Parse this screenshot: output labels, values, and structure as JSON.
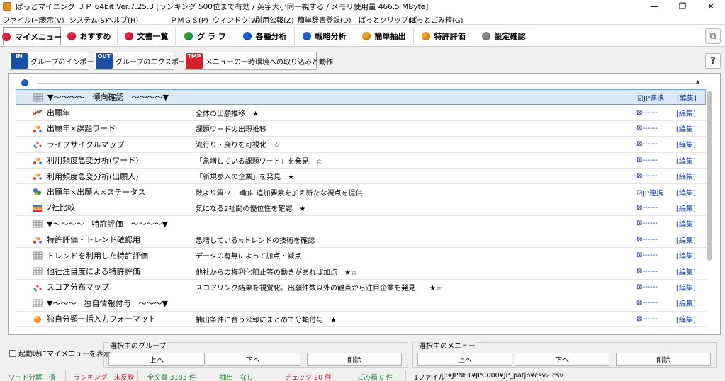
{
  "window": {
    "title": "ぱっとマイニング ＪＰ 64bit Ver.7.25.3 [ランキング 500位まで有効 / 英字大小同一視する / メモリ使用量 466.5 MByte]",
    "controls": [
      "—",
      "❐",
      "✕"
    ]
  },
  "menubar": [
    "ファイル(F)",
    "表示(V)",
    "システム(S)",
    "ヘルプ(H)",
    "ＰＭＧＳ(P)",
    "ウィンドウ(W)",
    "引用公報(Z)",
    "簡単辞書登録(D)",
    "ぱっとクリップ(8)",
    "ぱっとごみ箱(G)"
  ],
  "tabs": [
    {
      "label": "マイメニュー",
      "color": "#e8243c",
      "active": true
    },
    {
      "label": "おすすめ",
      "color": "#e8243c"
    },
    {
      "label": "文書一覧",
      "color": "#e8243c"
    },
    {
      "label": "グ ラ フ",
      "color": "#2aa13a"
    },
    {
      "label": "各種分析",
      "color": "#1565e0"
    },
    {
      "label": "戦略分析",
      "color": "#1565e0"
    },
    {
      "label": "簡単抽出",
      "color": "#f0a020"
    },
    {
      "label": "特許評価",
      "color": "#f0a020"
    },
    {
      "label": "設定確認",
      "color": "#8a8a8a"
    }
  ],
  "toolbar": {
    "import": {
      "icon_text": "IN",
      "label": "グループのインポート",
      "color": "#1a4fa8"
    },
    "export": {
      "icon_text": "OUT",
      "label": "グループのエクスポート",
      "color": "#1a4fa8"
    },
    "temp": {
      "icon_text": "TMP",
      "label": "メニューの一時環境への取り込みと動作",
      "color": "#d21f2a"
    },
    "help_icon": "?",
    "window_icon": "⧉"
  },
  "list": {
    "collapse_icon": "▴",
    "rows": [
      {
        "icon": "grid-icon",
        "name": "▼〜〜〜〜　傾向確認　〜〜〜〜▼",
        "desc": "",
        "link": "☑JP連携",
        "edit": "[編集]",
        "selected": true
      },
      {
        "icon": "line-chart-icon",
        "name": "出願年",
        "desc": "全体の出願推移　★",
        "link": "⊠------",
        "edit": "[編集]"
      },
      {
        "icon": "bubble-chart-icon",
        "name": "出願年×課題ワード",
        "desc": "課題ワードの出現推移",
        "link": "⊠------",
        "edit": "[編集]"
      },
      {
        "icon": "scatter-icon",
        "name": "ライフサイクルマップ",
        "desc": "流行り・廃りを可視化　☆",
        "link": "⊠------",
        "edit": "[編集]"
      },
      {
        "icon": "bubble-chart-icon",
        "name": "利用頻度急変分析(ワード)",
        "desc": "「急増している課題ワード」を発見　☆",
        "link": "⊠------",
        "edit": "[編集]"
      },
      {
        "icon": "bubble-chart-icon",
        "name": "利用頻度急変分析(出願人)",
        "desc": "「新規参入の企業」を発見　★",
        "link": "⊠------",
        "edit": "[編集]"
      },
      {
        "icon": "cluster-icon",
        "name": "出願年×出願人×ステータス",
        "desc": "数より質!?　3軸に追加要素を加え新たな視点を提供",
        "link": "☑JP連携",
        "edit": "[編集]"
      },
      {
        "icon": "stacked-bar-icon",
        "name": "2社比較",
        "desc": "気になる2社間の優位性を確認　★",
        "link": "⊠------",
        "edit": "[編集]"
      },
      {
        "icon": "grid-icon",
        "name": "▼〜〜〜〜　特許評価　〜〜〜〜▼",
        "desc": "",
        "link": "⊠------",
        "edit": "[編集]"
      },
      {
        "icon": "bubble-chart-icon",
        "name": "特許評価・トレンド確認用",
        "desc": "急増している≒トレンドの技術を確認",
        "link": "⊠------",
        "edit": "[編集]"
      },
      {
        "icon": "grid-icon",
        "name": "トレンドを利用した特許評価",
        "desc": "データの有無によって加点・減点",
        "link": "⊠------",
        "edit": "[編集]"
      },
      {
        "icon": "grid-icon",
        "name": "他社注目度による特許評価",
        "desc": "他社からの権利化阻止等の動きがあれば加点　★☆",
        "link": "⊠------",
        "edit": "[編集]"
      },
      {
        "icon": "scatter-icon",
        "name": "スコア分布マップ",
        "desc": "スコアリング結果を視覚化。出願件数以外の観点から注目企業を発見！　★☆",
        "link": "⊠------",
        "edit": "[編集]"
      },
      {
        "icon": "grid-icon",
        "name": "▼〜〜〜　独自情報付与　〜〜〜▼",
        "desc": "",
        "link": "⊠------",
        "edit": "[編集]"
      },
      {
        "icon": "orange-ball-icon",
        "name": "独自分類一括入力フォーマット",
        "desc": "抽出条件に合う公報にまとめて分類付与　★",
        "link": "⊠------",
        "edit": "[編集]"
      }
    ]
  },
  "bottom": {
    "startup_checkbox": "起動時にマイメニューを表示",
    "group_title": "選択中のグループ",
    "menu_title": "選択中のメニュー",
    "up": "上へ",
    "down": "下へ",
    "delete": "削除"
  },
  "status": {
    "word_split": "ワード分解　済",
    "ranking": "ランキング　未反映",
    "total": "全文書 3183 件",
    "extract": "抽出　なし",
    "check": "チェック 20 件",
    "trash": "ごみ箱 0 件",
    "files": "1ファイル",
    "path": "C:¥JPNET¥JPC000¥JP_patjp¥csv2.csv"
  },
  "colors": {
    "ranking": "#d21f2a",
    "green": "#2a8a3a",
    "check": "#d21f2a"
  }
}
